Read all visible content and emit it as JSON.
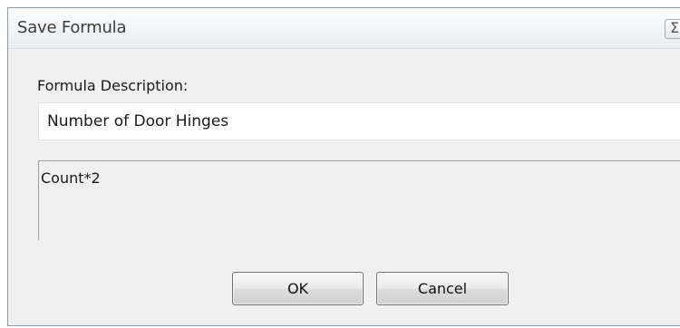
{
  "window": {
    "title": "Save Formula",
    "close_glyph": "Σ"
  },
  "form": {
    "description_label": "Formula Description:",
    "description_value": "Number of Door Hinges",
    "formula_text": "Count*2"
  },
  "buttons": {
    "ok_label": "OK",
    "cancel_label": "Cancel"
  }
}
